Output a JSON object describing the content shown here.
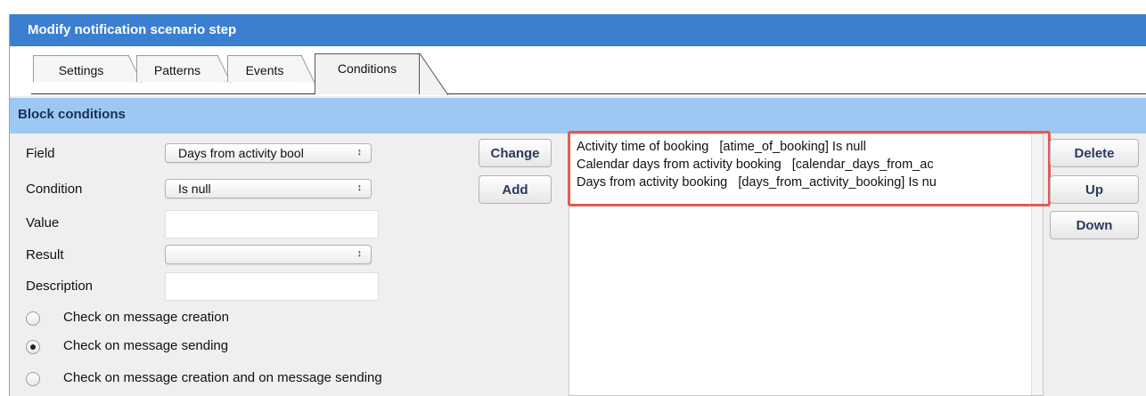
{
  "dialog": {
    "title": "Modify notification scenario step"
  },
  "tabs": [
    {
      "label": "Settings"
    },
    {
      "label": "Patterns"
    },
    {
      "label": "Events"
    },
    {
      "label": "Conditions"
    }
  ],
  "section": {
    "title": "Block conditions"
  },
  "form": {
    "field_label": "Field",
    "field_value": "Days from activity bool",
    "condition_label": "Condition",
    "condition_value": "Is null",
    "value_label": "Value",
    "value_value": "",
    "result_label": "Result",
    "result_value": "",
    "description_label": "Description",
    "description_value": ""
  },
  "radios": [
    {
      "label": "Check on message creation",
      "checked": false
    },
    {
      "label": "Check on message sending",
      "checked": true
    },
    {
      "label": "Check on message creation and on message sending",
      "checked": false
    }
  ],
  "buttons": {
    "change": "Change",
    "add": "Add",
    "delete": "Delete",
    "up": "Up",
    "down": "Down"
  },
  "conditions_list": [
    "Activity time of booking   [atime_of_booking] Is null",
    "Calendar days from activity booking   [calendar_days_from_ac",
    "Days from activity booking   [days_from_activity_booking] Is nu"
  ],
  "colors": {
    "title_bar": "#3b7fd0",
    "section_bar": "#9ec8f4",
    "highlight": "#e25a55"
  }
}
